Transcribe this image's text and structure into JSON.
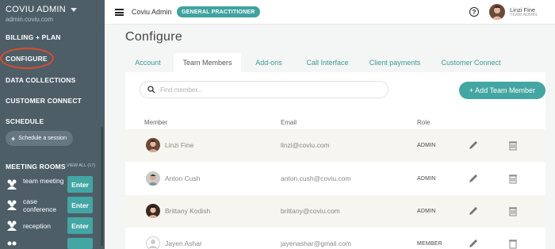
{
  "sidebar": {
    "org_title": "COVIU ADMIN",
    "org_domain": "admin.coviu.com",
    "links": [
      "BILLING + PLAN",
      "CONFIGURE",
      "DATA COLLECTIONS",
      "CUSTOMER CONNECT",
      "SCHEDULE"
    ],
    "schedule_button": "Schedule a session",
    "meeting_rooms_heading": "MEETING ROOMS",
    "view_all": "VIEW ALL (17)",
    "rooms": [
      {
        "label": "team meeting",
        "enter": "Enter"
      },
      {
        "label": "case conference",
        "enter": "Enter"
      },
      {
        "label": "reception",
        "enter": "Enter"
      }
    ]
  },
  "topbar": {
    "org_name": "Coviu Admin",
    "role_badge": "GENERAL PRACTITIONER",
    "help_icon": "?",
    "user_name": "Linzi Fine",
    "user_role": "TEAM ADMIN"
  },
  "main": {
    "title": "Configure",
    "tabs": [
      "Account",
      "Team Members",
      "Add-ons",
      "Call Interface",
      "Client payments",
      "Customer Connect"
    ],
    "active_tab": "Team Members",
    "search_placeholder": "Find member...",
    "add_button": "+ Add Team Member",
    "columns": [
      "Member",
      "Email",
      "Role"
    ],
    "members": [
      {
        "name": "Linzi Fine",
        "email": "linzi@coviu.com",
        "role": "ADMIN"
      },
      {
        "name": "Anton Cush",
        "email": "anton.cush@coviu.com",
        "role": "ADMIN"
      },
      {
        "name": "Brittany Kodish",
        "email": "brittany@coviu.com",
        "role": "ADMIN"
      },
      {
        "name": "Jayen Ashar",
        "email": "jayenashar@gmail.com",
        "role": "MEMBER"
      }
    ]
  },
  "colors": {
    "sidebar_bg": "#4d5e67",
    "accent_teal": "#44a6a3",
    "highlight_circle": "#e04a2e",
    "row_alt": "#f6f5ef"
  }
}
